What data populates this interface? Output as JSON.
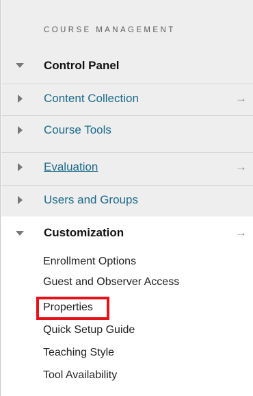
{
  "heading": "COURSE MANAGEMENT",
  "control_panel": {
    "label": "Control Panel",
    "items": [
      {
        "label": "Content Collection",
        "goto": "→"
      },
      {
        "label": "Course Tools"
      },
      {
        "label": "Evaluation",
        "goto": "→"
      },
      {
        "label": "Users and Groups"
      }
    ]
  },
  "customization": {
    "label": "Customization",
    "goto": "→",
    "sub_items": [
      "Enrollment Options",
      "Guest and Observer Access",
      "Properties",
      "Quick Setup Guide",
      "Teaching Style",
      "Tool Availability"
    ]
  },
  "colors": {
    "highlight": "#e5121b",
    "link": "#1a6a8a"
  },
  "icons": {
    "expanded": "triangle-down-icon",
    "collapsed": "triangle-right-icon",
    "goto": "arrow-right-icon"
  }
}
